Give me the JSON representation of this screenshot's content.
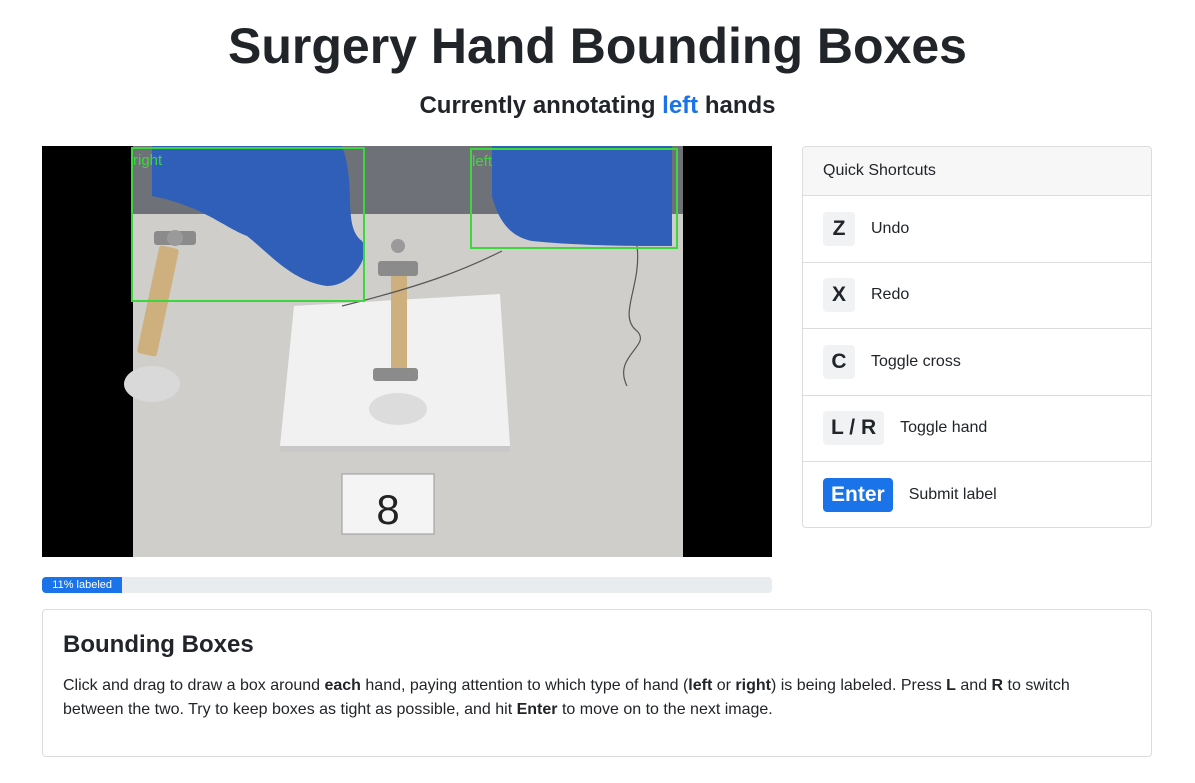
{
  "title": "Surgery Hand Bounding Boxes",
  "subtitle": {
    "prefix": "Currently annotating",
    "hand": "left",
    "suffix": "hands"
  },
  "image": {
    "card_number": "8",
    "boxes": [
      {
        "label": "right"
      },
      {
        "label": "left"
      }
    ]
  },
  "progress": {
    "percent": 11,
    "label": "11% labeled"
  },
  "shortcuts": {
    "header": "Quick Shortcuts",
    "items": [
      {
        "key": "Z",
        "label": "Undo"
      },
      {
        "key": "X",
        "label": "Redo"
      },
      {
        "key": "C",
        "label": "Toggle cross"
      },
      {
        "key": "L / R",
        "label": "Toggle hand"
      },
      {
        "key": "Enter",
        "label": "Submit label"
      }
    ]
  },
  "instructions": {
    "title": "Bounding Boxes",
    "t1": "Click and drag to draw a box around ",
    "b1": "each",
    "t2": " hand, paying attention to which type of hand (",
    "b2": "left",
    "t3": " or ",
    "b3": "right",
    "t4": ") is being labeled. Press ",
    "b4": "L",
    "t5": " and ",
    "b5": "R",
    "t6": " to switch between the two. Try to keep boxes as tight as possible, and hit ",
    "b6": "Enter",
    "t7": " to move on to the next image."
  },
  "colors": {
    "accent": "#1a73e8",
    "box": "#3ed63e",
    "glove": "#2f5fb8"
  }
}
